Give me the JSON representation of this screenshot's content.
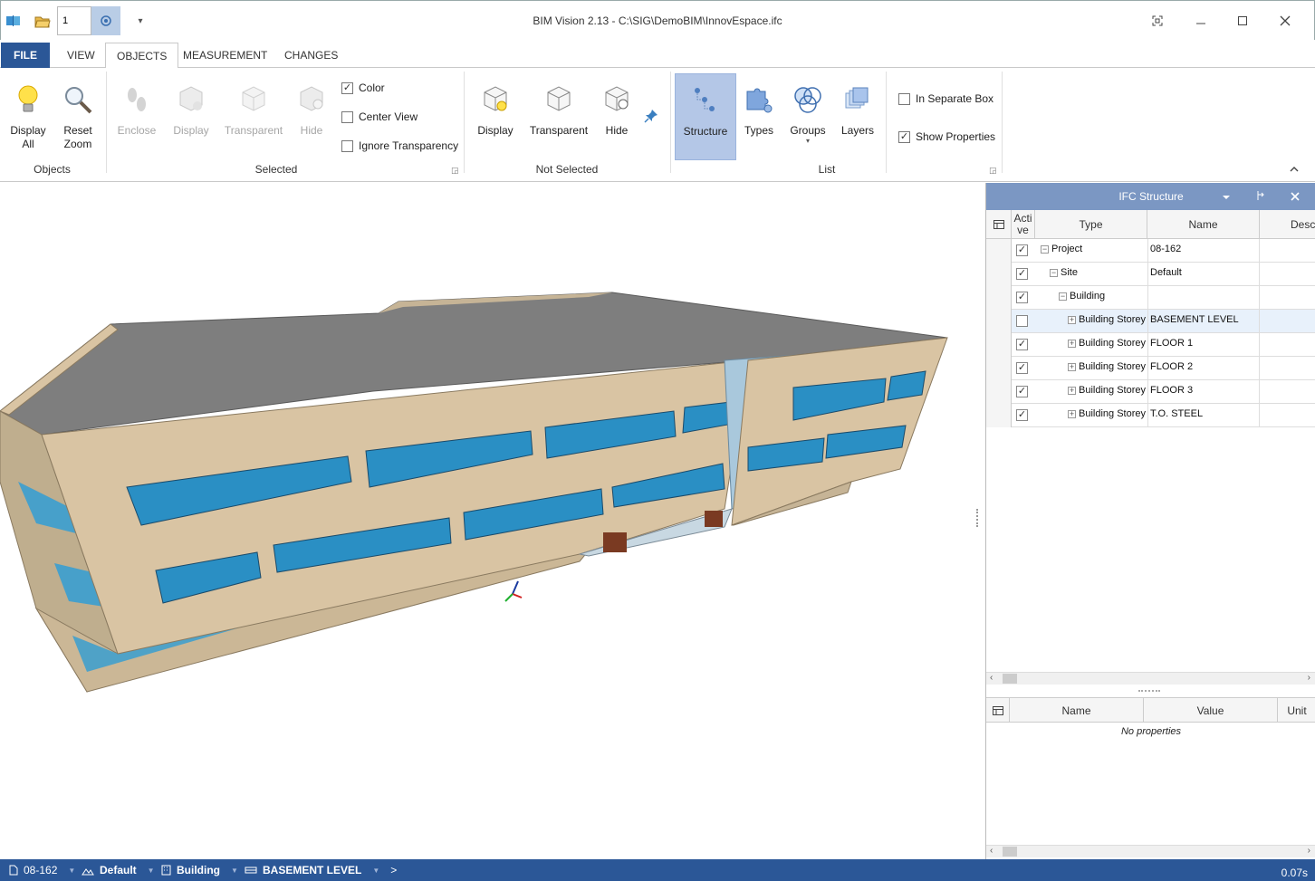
{
  "window": {
    "title": "BIM Vision 2.13 - C:\\SIG\\DemoBIM\\InnovEspace.ifc",
    "qat_value": "1"
  },
  "tabs": [
    {
      "label": "FILE"
    },
    {
      "label": "VIEW"
    },
    {
      "label": "OBJECTS"
    },
    {
      "label": "MEASUREMENT"
    },
    {
      "label": "CHANGES"
    }
  ],
  "ribbon": {
    "objects": {
      "display_all": "Display\nAll",
      "reset_zoom": "Reset\nZoom",
      "group_label": "Objects"
    },
    "selected": {
      "enclose": "Enclose",
      "display": "Display",
      "transparent": "Transparent",
      "hide": "Hide",
      "color": "Color",
      "center_view": "Center View",
      "ignore_transparency": "Ignore Transparency",
      "group_label": "Selected",
      "color_checked": true,
      "center_view_checked": false,
      "ignore_transparency_checked": false
    },
    "not_selected": {
      "display": "Display",
      "transparent": "Transparent",
      "hide": "Hide",
      "group_label": "Not Selected"
    },
    "list": {
      "structure": "Structure",
      "types": "Types",
      "groups": "Groups",
      "layers": "Layers",
      "in_separate_box": "In Separate Box",
      "show_properties": "Show Properties",
      "group_label": "List",
      "in_separate_box_checked": false,
      "show_properties_checked": true
    }
  },
  "ifc_panel": {
    "title": "IFC Structure",
    "columns": {
      "active": "Acti\nve",
      "type": "Type",
      "name": "Name",
      "description": "Descr"
    },
    "rows": [
      {
        "level": 0,
        "toggle": "minus",
        "type": "Project",
        "name": "08-162",
        "active": true
      },
      {
        "level": 1,
        "toggle": "minus",
        "type": "Site",
        "name": "Default",
        "active": true
      },
      {
        "level": 2,
        "toggle": "minus",
        "type": "Building",
        "name": "",
        "active": true
      },
      {
        "level": 3,
        "toggle": "plus",
        "type": "Building Storey",
        "name": "BASEMENT LEVEL",
        "active": false
      },
      {
        "level": 3,
        "toggle": "plus",
        "type": "Building Storey",
        "name": "FLOOR 1",
        "active": true
      },
      {
        "level": 3,
        "toggle": "plus",
        "type": "Building Storey",
        "name": "FLOOR 2",
        "active": true
      },
      {
        "level": 3,
        "toggle": "plus",
        "type": "Building Storey",
        "name": "FLOOR 3",
        "active": true
      },
      {
        "level": 3,
        "toggle": "plus",
        "type": "Building Storey",
        "name": "T.O. STEEL",
        "active": true
      }
    ],
    "props_columns": {
      "name": "Name",
      "value": "Value",
      "unit": "Unit"
    },
    "no_properties": "No properties"
  },
  "statusbar": {
    "project": "08-162",
    "site": "Default",
    "building": "Building",
    "storey": "BASEMENT LEVEL",
    "more": ">",
    "time": "0.07s"
  },
  "colors": {
    "accent": "#2b5797",
    "panel_header": "#7b97c3",
    "selected_button": "#b4c7e7",
    "glass": "#3a9fd0",
    "wall": "#d9c4a3",
    "roof": "#7e7e7e"
  }
}
